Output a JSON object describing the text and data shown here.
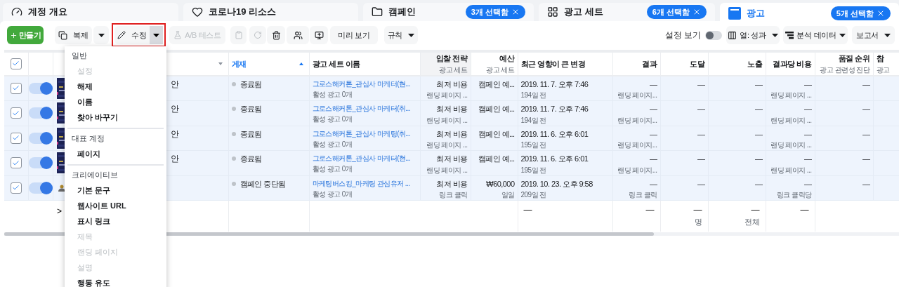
{
  "tabs": [
    {
      "label": "계정 개요",
      "selected": false
    },
    {
      "label": "코로나19 리소스",
      "selected": false
    },
    {
      "label": "캠페인",
      "badge": "3개 선택함",
      "selected": false
    },
    {
      "label": "광고 세트",
      "badge": "6개 선택함",
      "selected": false
    },
    {
      "label": "광고",
      "badge": "5개 선택함",
      "selected": true
    }
  ],
  "toolbar": {
    "create": "만들기",
    "duplicate": "복제",
    "edit": "수정",
    "edit_highlighted": true,
    "ab_test": "A/B 테스트",
    "ab_test_disabled": true,
    "preview": "미리 보기",
    "rules": "규칙",
    "view_settings": "설정 보기",
    "view_settings_on": false,
    "columns": "열: 성과",
    "breakdown": "분석 데이터",
    "reports": "보고서"
  },
  "table": {
    "columns": [
      {
        "numeric": false,
        "sorted": false,
        "highlighted": false,
        "caret": true
      },
      {
        "label": "게재",
        "numeric": false,
        "sorted": true,
        "highlighted": false,
        "caret": false
      },
      {
        "label": "광고 세트 이름",
        "numeric": false,
        "sorted": false,
        "highlighted": false,
        "caret": false
      },
      {
        "label": "입찰 전략",
        "sub": "광고 세트",
        "numeric": true,
        "sorted": false,
        "highlighted": true,
        "caret": false
      },
      {
        "label": "예산",
        "sub": "광고 세트",
        "numeric": true,
        "sorted": false,
        "highlighted": false,
        "caret": false
      },
      {
        "label": "최근 영향이 큰 변경",
        "numeric": false,
        "sorted": false,
        "highlighted": false,
        "caret": false
      },
      {
        "label": "결과",
        "numeric": true,
        "sorted": false,
        "highlighted": false,
        "caret": false
      },
      {
        "label": "도달",
        "numeric": true,
        "sorted": false,
        "highlighted": false,
        "caret": false
      },
      {
        "label": "노출",
        "numeric": true,
        "sorted": false,
        "highlighted": false,
        "caret": false
      },
      {
        "label": "결과당 비용",
        "numeric": true,
        "sorted": false,
        "highlighted": false,
        "caret": false
      },
      {
        "label": "품질 순위",
        "sub": "광고 관련성 진단",
        "numeric": true,
        "sorted": false,
        "highlighted": false,
        "caret": false
      },
      {
        "label": "참",
        "sub": "광고",
        "numeric": false,
        "sorted": false,
        "highlighted": false,
        "caret": false
      }
    ],
    "all_selected": true,
    "rows": [
      {
        "selected": true,
        "on": true,
        "kind": "picture",
        "name": "안",
        "delivery": "종료됨",
        "adset": "그로스해커톤_관심사 마케터(현...",
        "adset_sub": "활성 광고 0개",
        "bid": "최저 비용",
        "bid_sub": "랜딩 페이지 ...",
        "budget": "캠페인 예...",
        "changed": "2019. 11. 7. 오후 7:46",
        "changed_ago": "194일 전",
        "result": "—",
        "result_sub": "랜딩 페이지...",
        "reach": "—",
        "impressions": "—",
        "cpr": "—",
        "cpr_sub": "랜딩 페이지 ...",
        "quality": "—"
      },
      {
        "selected": true,
        "on": true,
        "kind": "picture",
        "name": "안",
        "delivery": "종료됨",
        "adset": "그로스해커톤_관심사 마케터(취...",
        "adset_sub": "활성 광고 0개",
        "bid": "최저 비용",
        "bid_sub": "랜딩 페이지 ...",
        "budget": "캠페인 예...",
        "changed": "2019. 11. 7. 오후 7:46",
        "changed_ago": "194일 전",
        "result": "—",
        "result_sub": "랜딩 페이지...",
        "reach": "—",
        "impressions": "—",
        "cpr": "—",
        "cpr_sub": "랜딩 페이지 ...",
        "quality": "—"
      },
      {
        "selected": true,
        "on": true,
        "kind": "picture",
        "name": "안",
        "delivery": "종료됨",
        "adset": "그로스해커톤_관심사 마케팅(취...",
        "adset_sub": "활성 광고 0개",
        "bid": "최저 비용",
        "bid_sub": "랜딩 페이지 ...",
        "budget": "캠페인 예...",
        "changed": "2019. 11. 6. 오후 6:01",
        "changed_ago": "195일 전",
        "result": "—",
        "result_sub": "랜딩 페이지...",
        "reach": "—",
        "impressions": "—",
        "cpr": "—",
        "cpr_sub": "랜딩 페이지 ...",
        "quality": "—"
      },
      {
        "selected": true,
        "on": true,
        "kind": "picture",
        "name": "안",
        "delivery": "종료됨",
        "adset": "그로스해커톤_관심사 마케터(현...",
        "adset_sub": "활성 광고 0개",
        "bid": "최저 비용",
        "bid_sub": "랜딩 페이지 ...",
        "budget": "캠페인 예...",
        "changed": "2019. 11. 6. 오후 6:01",
        "changed_ago": "195일 전",
        "result": "—",
        "result_sub": "랜딩 페이지...",
        "reach": "—",
        "impressions": "—",
        "cpr": "—",
        "cpr_sub": "랜딩 페이지 ...",
        "quality": "—"
      },
      {
        "selected": true,
        "on": true,
        "kind": "icon",
        "delivery": "캠페인 중단됨",
        "adset": "마케팅버스킹_마케팅 관심유저 ...",
        "adset_sub": "활성 광고 0개",
        "bid": "최저 비용",
        "bid_sub": "링크 클릭",
        "budget": "₩60,000",
        "budget_sub": "일일",
        "changed": "2019. 10. 23. 오후 9:58",
        "changed_ago": "209일 전",
        "result": "—",
        "result_sub": "링크 클릭",
        "reach": "—",
        "impressions": "—",
        "cpr": "—",
        "cpr_sub": "링크 클릭당",
        "quality": "—"
      }
    ],
    "summary": {
      "expand": ">",
      "changed": "—",
      "result": "—",
      "reach": "—",
      "reach_sub": "명",
      "impressions": "—",
      "impressions_sub": "전체",
      "cpr": "—"
    }
  },
  "edit_menu": [
    {
      "title": "일반",
      "items": [
        {
          "label": "설정",
          "disabled": true
        },
        {
          "label": "해제",
          "disabled": false
        },
        {
          "label": "이름",
          "disabled": false
        },
        {
          "label": "찾아 바꾸기",
          "disabled": false
        }
      ]
    },
    {
      "title": "대표 계정",
      "items": [
        {
          "label": "페이지",
          "disabled": false
        }
      ]
    },
    {
      "title": "크리에이티브",
      "items": [
        {
          "label": "기본 문구",
          "disabled": false
        },
        {
          "label": "웹사이트 URL",
          "disabled": false
        },
        {
          "label": "표시 링크",
          "disabled": false
        },
        {
          "label": "제목",
          "disabled": true
        },
        {
          "label": "랜딩 페이지",
          "disabled": true
        },
        {
          "label": "설명",
          "disabled": true
        },
        {
          "label": "행동 유도",
          "disabled": false
        }
      ]
    }
  ]
}
